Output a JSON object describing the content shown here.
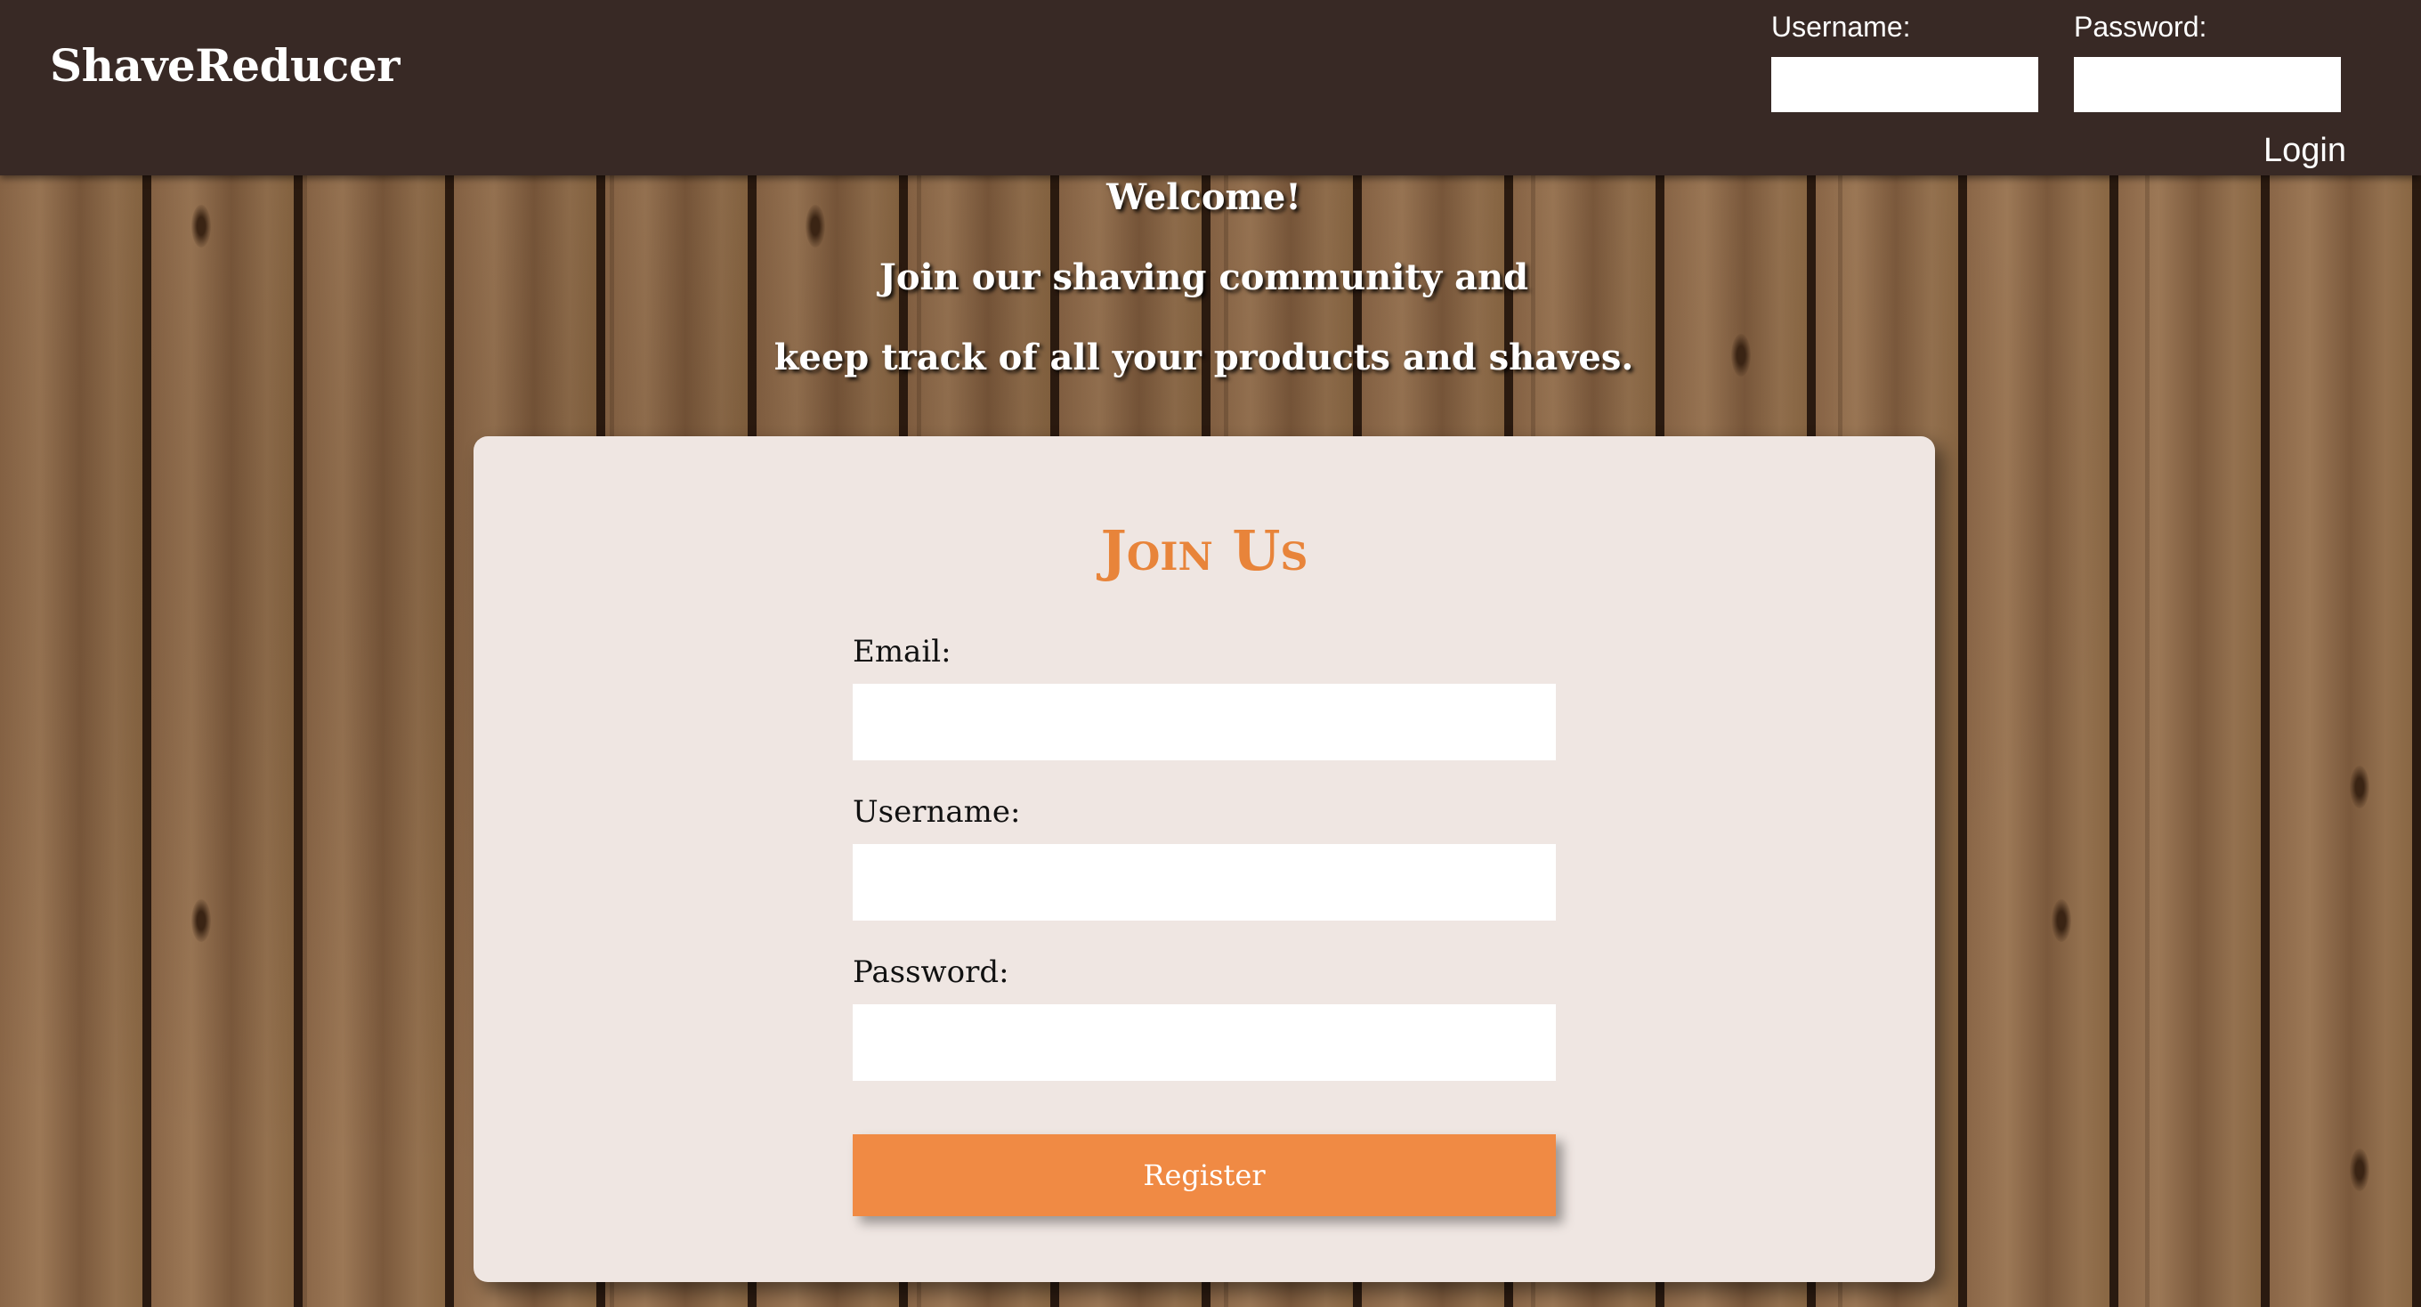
{
  "header": {
    "brand": "ShaveReducer",
    "username_label": "Username:",
    "password_label": "Password:",
    "username_value": "",
    "password_value": "",
    "login_label": "Login"
  },
  "welcome": {
    "line1": "Welcome!",
    "line2": "Join our shaving community and",
    "line3": "keep track of all your products and shaves."
  },
  "register_form": {
    "title": "Join Us",
    "email_label": "Email:",
    "email_value": "",
    "username_label": "Username:",
    "username_value": "",
    "password_label": "Password:",
    "password_value": "",
    "submit_label": "Register"
  },
  "colors": {
    "header_bg": "#382925",
    "accent": "#f08a44",
    "title": "#e8843a",
    "card_bg": "#efe6e2"
  }
}
